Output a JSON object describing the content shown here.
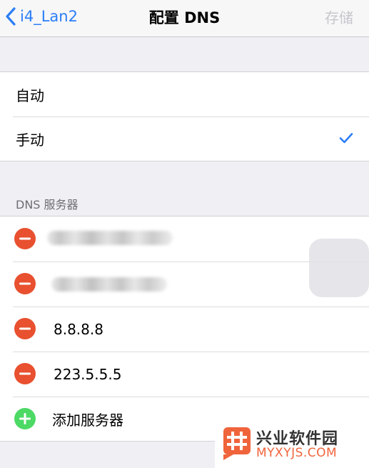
{
  "navbar": {
    "back_label": "i4_Lan2",
    "title": "配置 DNS",
    "save_label": "存储"
  },
  "configure": {
    "options": [
      {
        "label": "自动",
        "selected": false
      },
      {
        "label": "手动",
        "selected": true
      }
    ]
  },
  "dns": {
    "section_header": "DNS 服务器",
    "servers": [
      "8.8.8.8",
      "223.5.5.5"
    ],
    "add_label": "添加服务器"
  },
  "watermark": {
    "title": "兴业软件园",
    "subtitle": "MYXYJS.COM"
  },
  "colors": {
    "accent": "#2b7ef6",
    "delete": "#e8502f",
    "add": "#4cd964"
  }
}
